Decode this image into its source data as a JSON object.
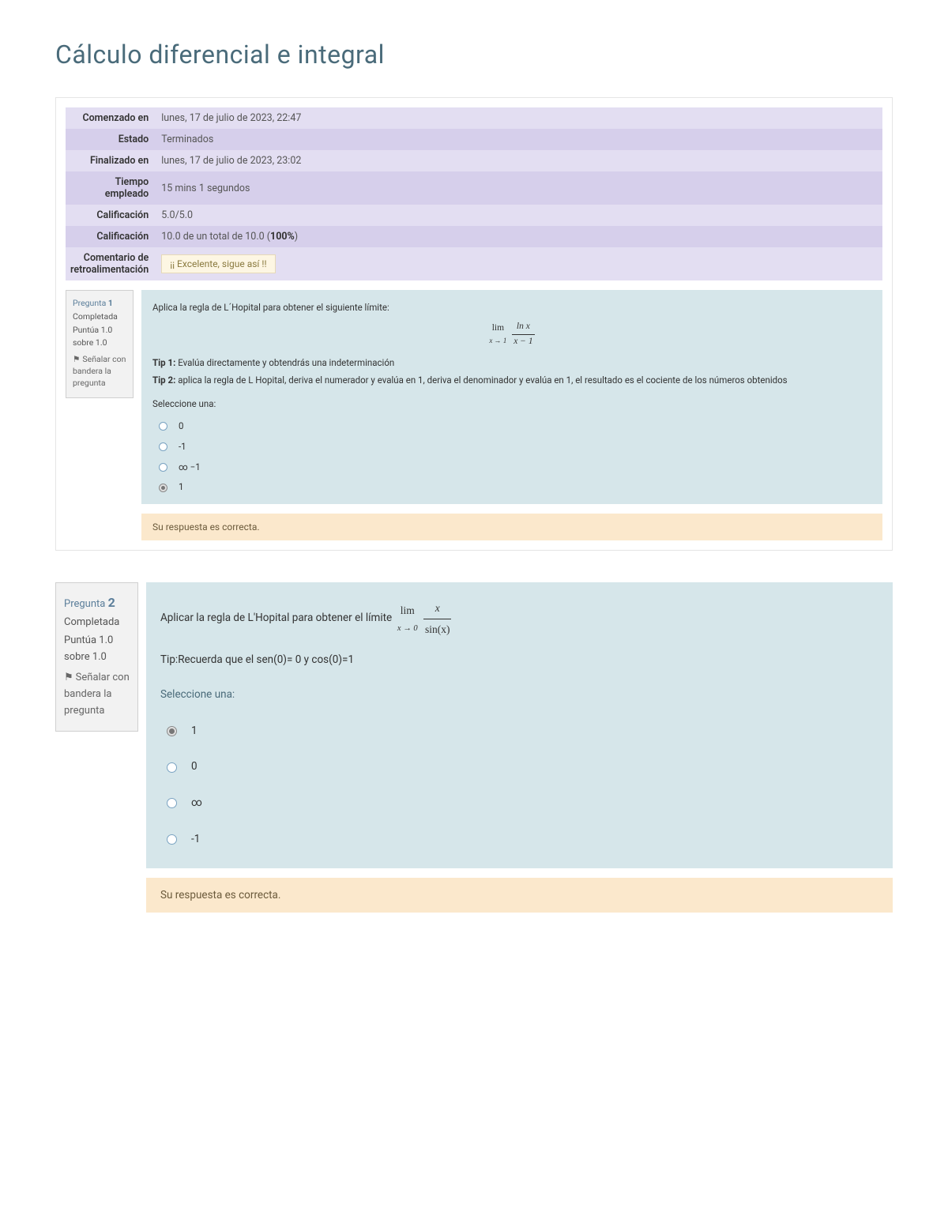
{
  "title": "Cálculo diferencial e integral",
  "summary": {
    "rows": [
      {
        "label": "Comenzado en",
        "value": "lunes, 17 de julio de 2023, 22:47"
      },
      {
        "label": "Estado",
        "value": "Terminados"
      },
      {
        "label": "Finalizado en",
        "value": "lunes, 17 de julio de 2023, 23:02"
      },
      {
        "label": "Tiempo empleado",
        "value": "15 mins 1 segundos"
      },
      {
        "label": "Calificación",
        "value": "5.0/5.0"
      },
      {
        "label": "Calificación",
        "value_html": "10.0 de un total de 10.0 (<strong>100%</strong>)"
      },
      {
        "label": "Comentario de retroalimentación",
        "feedback": "¡¡ Excelente, sigue así !!"
      }
    ]
  },
  "q1": {
    "label_prefix": "Pregunta",
    "number": "1",
    "state": "Completada",
    "score": "Puntúa 1.0 sobre 1.0",
    "flag_text": "Señalar con bandera la pregunta",
    "prompt": "Aplica la regla de L´Hopital para obtener el siguiente límite:",
    "lim_approach": "x → 1",
    "frac_num": "ln x",
    "frac_den": "x − 1",
    "tip1_label": "Tip 1:",
    "tip1_text": "Evalúa directamente y obtendrás una indeterminación",
    "tip2_label": "Tip 2:",
    "tip2_text": "aplica la regla de L Hopital, deriva el numerador y evalúa en 1,  deriva el denominador y evalúa en 1, el resultado es el cociente de los números obtenidos",
    "select_label": "Seleccione una:",
    "options": [
      {
        "label": "0",
        "checked": false
      },
      {
        "label": "-1",
        "checked": false
      },
      {
        "label": "∞ −1",
        "checked": false
      },
      {
        "label": "1",
        "checked": true
      }
    ],
    "feedback": "Su respuesta es correcta."
  },
  "q2": {
    "label_prefix": "Pregunta",
    "number": "2",
    "state": "Completada",
    "score": "Puntúa 1.0 sobre 1.0",
    "flag_text": "Señalar con bandera la pregunta",
    "prompt_prefix": "Aplicar la regla de L'Hopital para obtener el límite",
    "lim_approach": "x → 0",
    "frac_num": "x",
    "frac_den": "sin(x)",
    "tip": "Tip:Recuerda que el sen(0)= 0 y cos(0)=1",
    "select_label": "Seleccione una:",
    "options": [
      {
        "label": "1",
        "checked": true
      },
      {
        "label": "0",
        "checked": false
      },
      {
        "label": "∞",
        "checked": false
      },
      {
        "label": "-1",
        "checked": false
      }
    ],
    "feedback": "Su respuesta es correcta."
  }
}
